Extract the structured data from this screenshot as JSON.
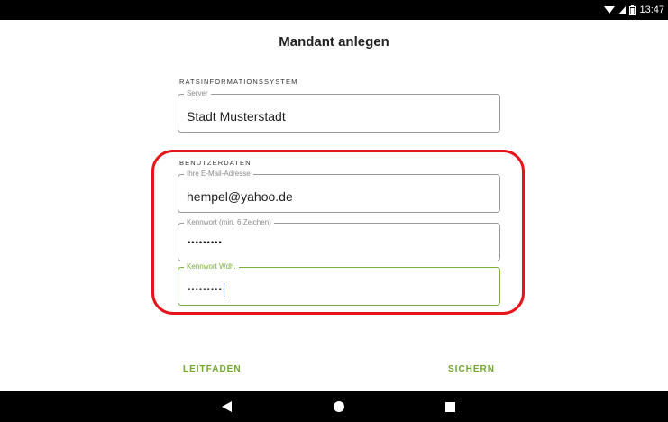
{
  "status_bar": {
    "time": "13:47"
  },
  "title": "Mandant anlegen",
  "ris_section": {
    "label": "RATSINFORMATIONSSYSTEM",
    "server": {
      "label": "Server",
      "value": "Stadt Musterstadt"
    }
  },
  "user_section": {
    "label": "BENUTZERDATEN",
    "email": {
      "label": "Ihre E-Mail-Adresse",
      "value": "hempel@yahoo.de"
    },
    "password": {
      "label": "Kennwort (min. 6 Zeichen)",
      "value": "•••••••••"
    },
    "password_repeat": {
      "label": "Kennwort Wdh.",
      "value": "•••••••••"
    }
  },
  "actions": {
    "guide_label": "LEITFADEN",
    "save_label": "SICHERN"
  },
  "colors": {
    "accent": "#7ab03a",
    "highlight": "#e8141b"
  }
}
